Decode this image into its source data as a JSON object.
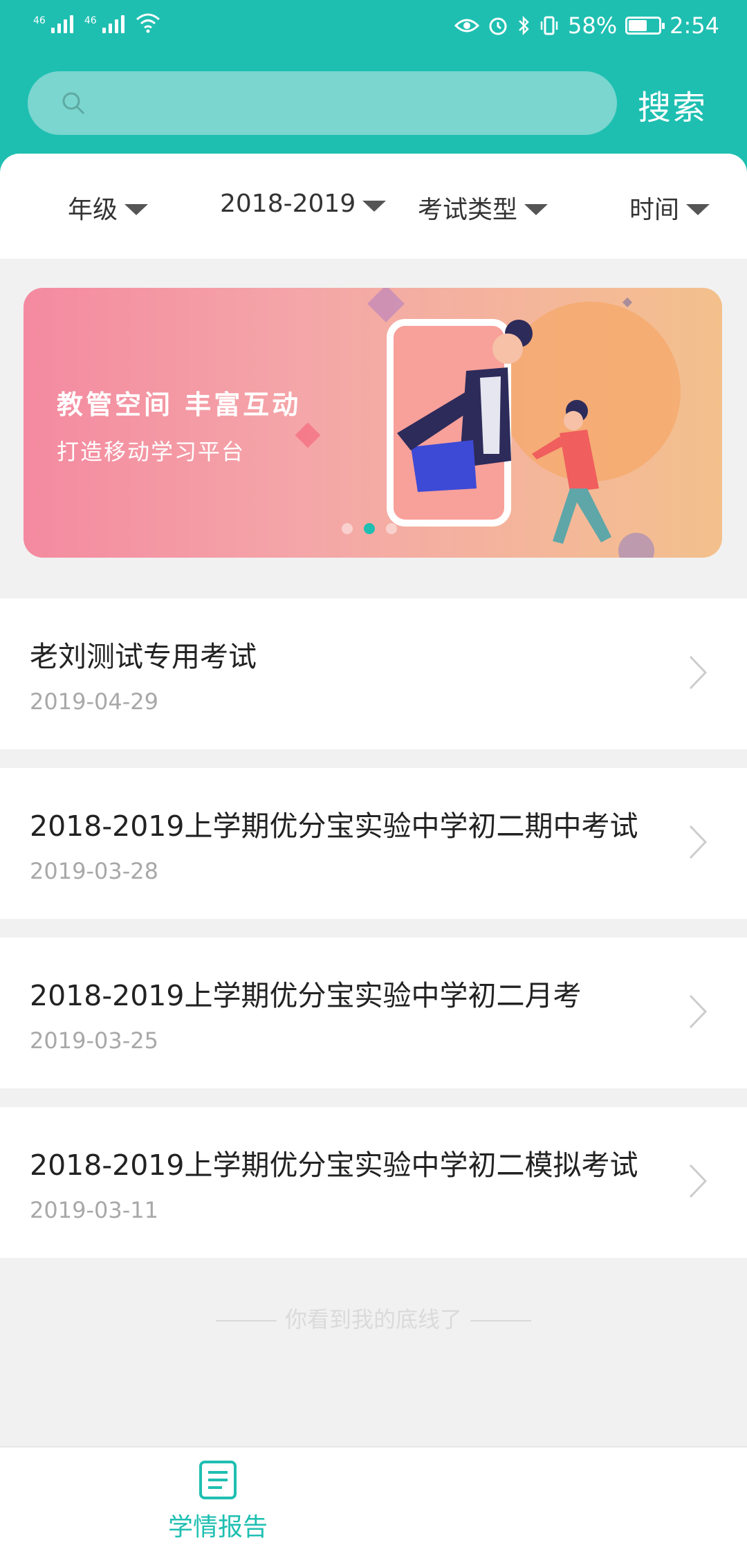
{
  "status_bar": {
    "signal1": "46",
    "signal2": "46",
    "battery_percent": "58%",
    "time": "2:54"
  },
  "search": {
    "placeholder": "",
    "button_label": "搜索"
  },
  "filters": [
    {
      "label": "年级"
    },
    {
      "label": "2018-2019"
    },
    {
      "label": "考试类型"
    },
    {
      "label": "时间"
    }
  ],
  "banner": {
    "title": "教管空间 丰富互动",
    "subtitle": "打造移动学习平台",
    "active_slide": 2,
    "slide_count": 3
  },
  "exams": [
    {
      "title": "老刘测试专用考试",
      "date": "2019-04-29"
    },
    {
      "title": "2018-2019上学期优分宝实验中学初二期中考试",
      "date": "2019-03-28"
    },
    {
      "title": "2018-2019上学期优分宝实验中学初二月考",
      "date": "2019-03-25"
    },
    {
      "title": "2018-2019上学期优分宝实验中学初二模拟考试",
      "date": "2019-03-11"
    }
  ],
  "footer_note": "你看到我的底线了",
  "bottom_nav": {
    "items": [
      {
        "label": "学情报告",
        "icon": "report-icon",
        "active": true
      }
    ]
  },
  "colors": {
    "accent": "#1ebfb1",
    "search_bg": "#7ad6cf"
  }
}
